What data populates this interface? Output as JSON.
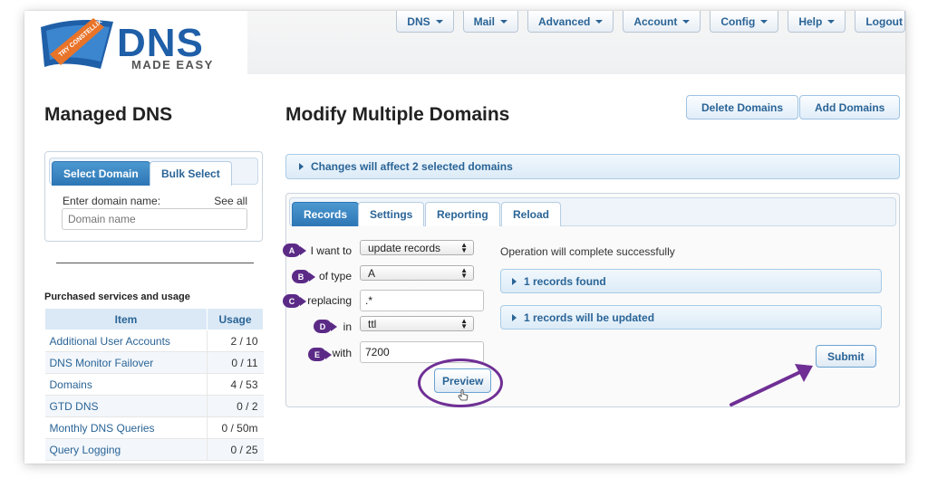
{
  "logo": {
    "brand": "DNS",
    "tagline": "MADE EASY",
    "ribbon": "TRY CONSTELLIX"
  },
  "nav": [
    {
      "label": "DNS",
      "icon": "chevron-down-icon"
    },
    {
      "label": "Mail",
      "icon": "chevron-down-icon"
    },
    {
      "label": "Advanced",
      "icon": "chevron-down-icon"
    },
    {
      "label": "Account",
      "icon": "chevron-down-icon"
    },
    {
      "label": "Config",
      "icon": "chevron-down-icon"
    },
    {
      "label": "Help",
      "icon": "chevron-down-icon"
    },
    {
      "label": "Logout"
    }
  ],
  "sidebar": {
    "title": "Managed DNS",
    "tabs": [
      {
        "label": "Select Domain",
        "active": true
      },
      {
        "label": "Bulk Select",
        "active": false
      }
    ],
    "enter_label": "Enter domain name:",
    "see_all": "See all",
    "domain_placeholder": "Domain name",
    "purchased_title": "Purchased services and usage",
    "table": {
      "headers": [
        "Item",
        "Usage"
      ],
      "rows": [
        [
          "Additional User Accounts",
          "2 / 10"
        ],
        [
          "DNS Monitor Failover",
          "0 / 11"
        ],
        [
          "Domains",
          "4 / 53"
        ],
        [
          "GTD DNS",
          "0 / 2"
        ],
        [
          "Monthly DNS Queries",
          "0 / 50m"
        ],
        [
          "Query Logging",
          "0 / 25"
        ]
      ]
    }
  },
  "main": {
    "title": "Modify Multiple Domains",
    "delete_button": "Delete Domains",
    "add_button": "Add Domains",
    "changes_bar": "Changes will affect 2 selected domains",
    "tabs": [
      {
        "label": "Records",
        "active": true
      },
      {
        "label": "Settings",
        "active": false
      },
      {
        "label": "Reporting",
        "active": false
      },
      {
        "label": "Reload",
        "active": false
      }
    ],
    "form": {
      "want_label": "I want to",
      "want_value": "update records",
      "type_label": "of type",
      "type_value": "A",
      "replacing_label": "replacing",
      "replacing_value": ".*",
      "in_label": "in",
      "in_value": "ttl",
      "with_label": "with",
      "with_value": "7200",
      "badges": [
        "A",
        "B",
        "C",
        "D",
        "E"
      ]
    },
    "preview_button": "Preview",
    "status": "Operation will complete successfully",
    "found_bar": "1 records found",
    "updated_bar": "1 records will be updated",
    "submit_button": "Submit"
  },
  "colors": {
    "accent": "#2a6496",
    "annotation": "#6f2f95",
    "active_tab": "#2d76b5"
  }
}
